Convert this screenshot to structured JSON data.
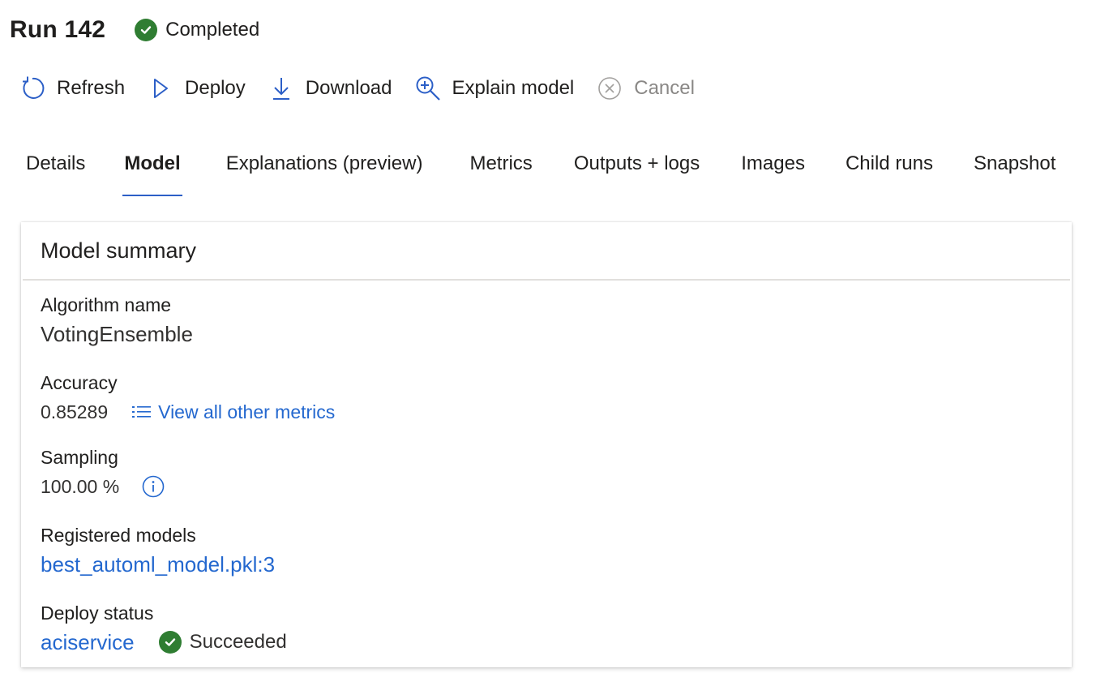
{
  "header": {
    "title": "Run 142",
    "status": "Completed"
  },
  "toolbar": {
    "refresh": "Refresh",
    "deploy": "Deploy",
    "download": "Download",
    "explain": "Explain model",
    "cancel": "Cancel"
  },
  "tabs": [
    {
      "label": "Details"
    },
    {
      "label": "Model"
    },
    {
      "label": "Explanations (preview)"
    },
    {
      "label": "Metrics"
    },
    {
      "label": "Outputs + logs"
    },
    {
      "label": "Images"
    },
    {
      "label": "Child runs"
    },
    {
      "label": "Snapshot"
    }
  ],
  "active_tab": "Model",
  "card": {
    "title": "Model summary",
    "algorithm": {
      "label": "Algorithm name",
      "value": "VotingEnsemble"
    },
    "accuracy": {
      "label": "Accuracy",
      "value": "0.85289",
      "link": "View all other metrics"
    },
    "sampling": {
      "label": "Sampling",
      "value": "100.00 %"
    },
    "registered": {
      "label": "Registered models",
      "value": "best_automl_model.pkl:3"
    },
    "deploy": {
      "label": "Deploy status",
      "value": "aciservice",
      "status": "Succeeded"
    }
  },
  "colors": {
    "accent": "#2c5fc7",
    "link": "#2468cf",
    "success": "#2f7d32",
    "disabled": "#8a8886"
  },
  "icons": [
    "check-circle-icon",
    "refresh-icon",
    "play-icon",
    "download-icon",
    "zoom-in-icon",
    "cancel-icon",
    "list-icon",
    "info-icon"
  ]
}
